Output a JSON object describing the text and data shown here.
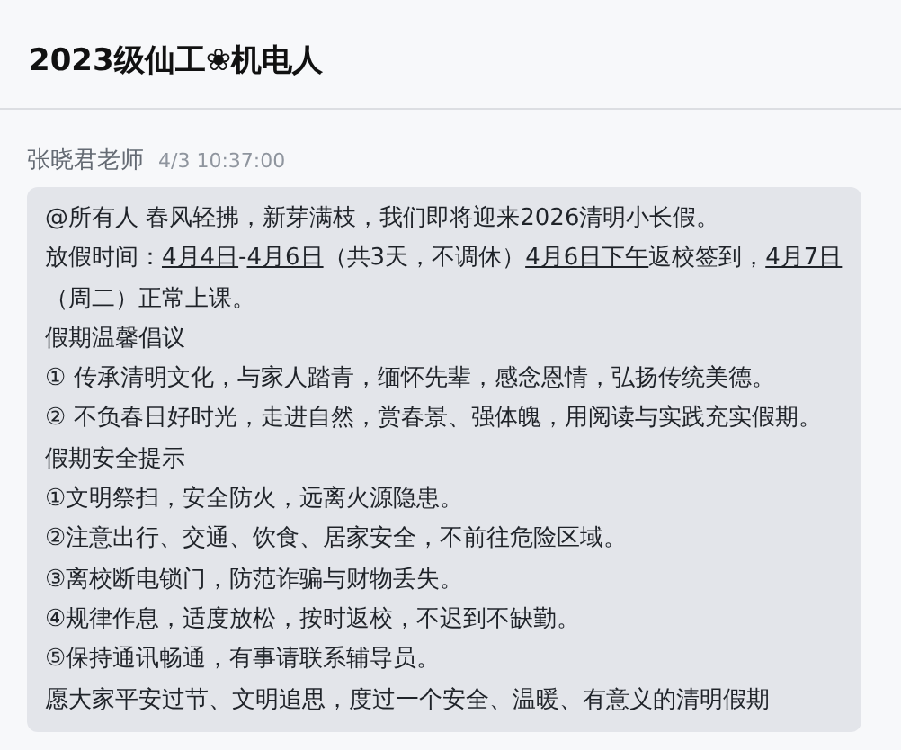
{
  "header": {
    "title": "2023级仙工❀机电人"
  },
  "message": {
    "sender": "张晓君老师",
    "time": "4/3 10:37:00",
    "paragraphs": [
      [
        {
          "text": "@所有人 春风轻拂，新芽满枝，我们即将迎来2026清明小长假。",
          "underline": false
        }
      ],
      [
        {
          "text": "放假时间：",
          "underline": false
        },
        {
          "text": "4月4日",
          "underline": true
        },
        {
          "text": "-",
          "underline": false
        },
        {
          "text": "4月6日",
          "underline": true
        },
        {
          "text": "（共3天，不调休）",
          "underline": false
        },
        {
          "text": "4月6日下午",
          "underline": true
        },
        {
          "text": "返校签到，",
          "underline": false
        },
        {
          "text": "4月7日",
          "underline": true
        },
        {
          "text": "（周二）正常上课。",
          "underline": false
        }
      ],
      [
        {
          "text": "假期温馨倡议",
          "underline": false
        }
      ],
      [
        {
          "text": "① 传承清明文化，与家人踏青，缅怀先辈，感念恩情，弘扬传统美德。",
          "underline": false
        }
      ],
      [
        {
          "text": "② 不负春日好时光，走进自然，赏春景、强体魄，用阅读与实践充实假期。",
          "underline": false
        }
      ],
      [
        {
          "text": "假期安全提示",
          "underline": false
        }
      ],
      [
        {
          "text": "①文明祭扫，安全防火，远离火源隐患。",
          "underline": false
        }
      ],
      [
        {
          "text": "②注意出行、交通、饮食、居家安全，不前往危险区域。",
          "underline": false
        }
      ],
      [
        {
          "text": "③离校断电锁门，防范诈骗与财物丢失。",
          "underline": false
        }
      ],
      [
        {
          "text": "④规律作息，适度放松，按时返校，不迟到不缺勤。",
          "underline": false
        }
      ],
      [
        {
          "text": "⑤保持通讯畅通，有事请联系辅导员。",
          "underline": false
        }
      ],
      [
        {
          "text": "愿大家平安过节、文明追思，度过一个安全、温暖、有意义的清明假期",
          "underline": false
        }
      ]
    ]
  }
}
